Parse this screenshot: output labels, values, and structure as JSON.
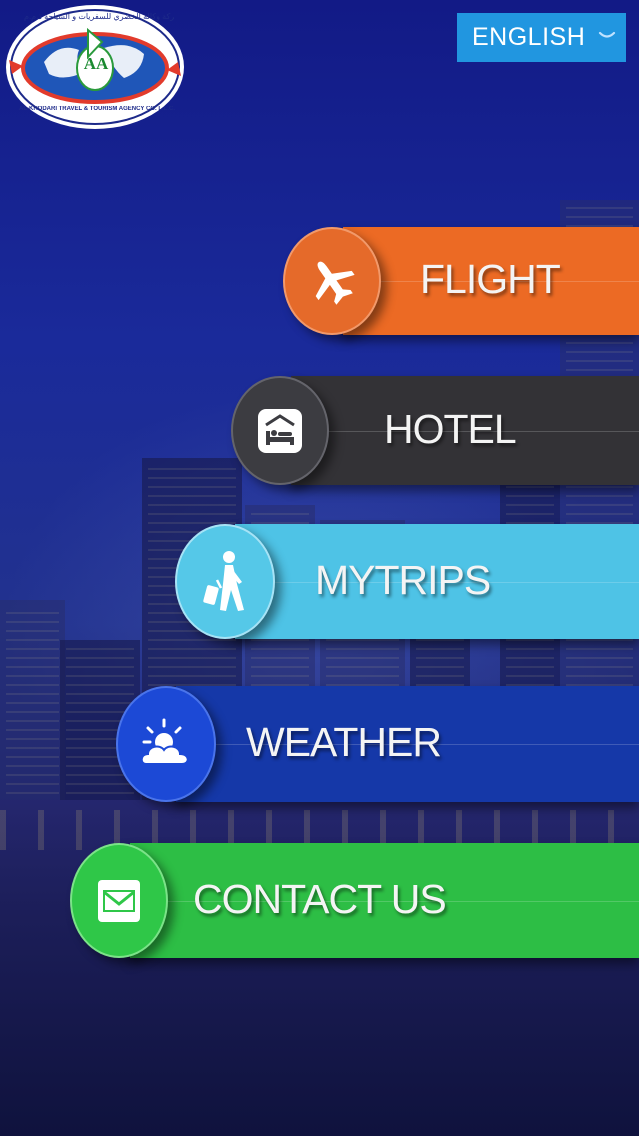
{
  "logo": {
    "arabic_text": "شركة وكالة الخضري للسفريات و السياحة ذ.م.م",
    "english_text": "AL-KHODARI TRAVEL & TOURISM AGENCY CO. L.L.C.",
    "monogram": "AA"
  },
  "language": {
    "selected": "ENGLISH"
  },
  "menu": [
    {
      "id": "flight",
      "label": "FLIGHT",
      "icon": "airplane-icon",
      "bar_color": "#ec6a24",
      "circle_color": "#e56a2a"
    },
    {
      "id": "hotel",
      "label": "HOTEL",
      "icon": "hotel-icon",
      "bar_color": "#333236",
      "circle_color": "#3c3c41"
    },
    {
      "id": "mytrips",
      "label": "MYTRIPS",
      "icon": "traveler-icon",
      "bar_color": "#4ec3e6",
      "circle_color": "#55c8e8"
    },
    {
      "id": "weather",
      "label": "WEATHER",
      "icon": "weather-icon",
      "bar_color": "#1538a8",
      "circle_color": "#1c49d6"
    },
    {
      "id": "contact",
      "label": "CONTACT US",
      "icon": "envelope-icon",
      "bar_color": "#2dbe45",
      "circle_color": "#2fc748"
    }
  ]
}
